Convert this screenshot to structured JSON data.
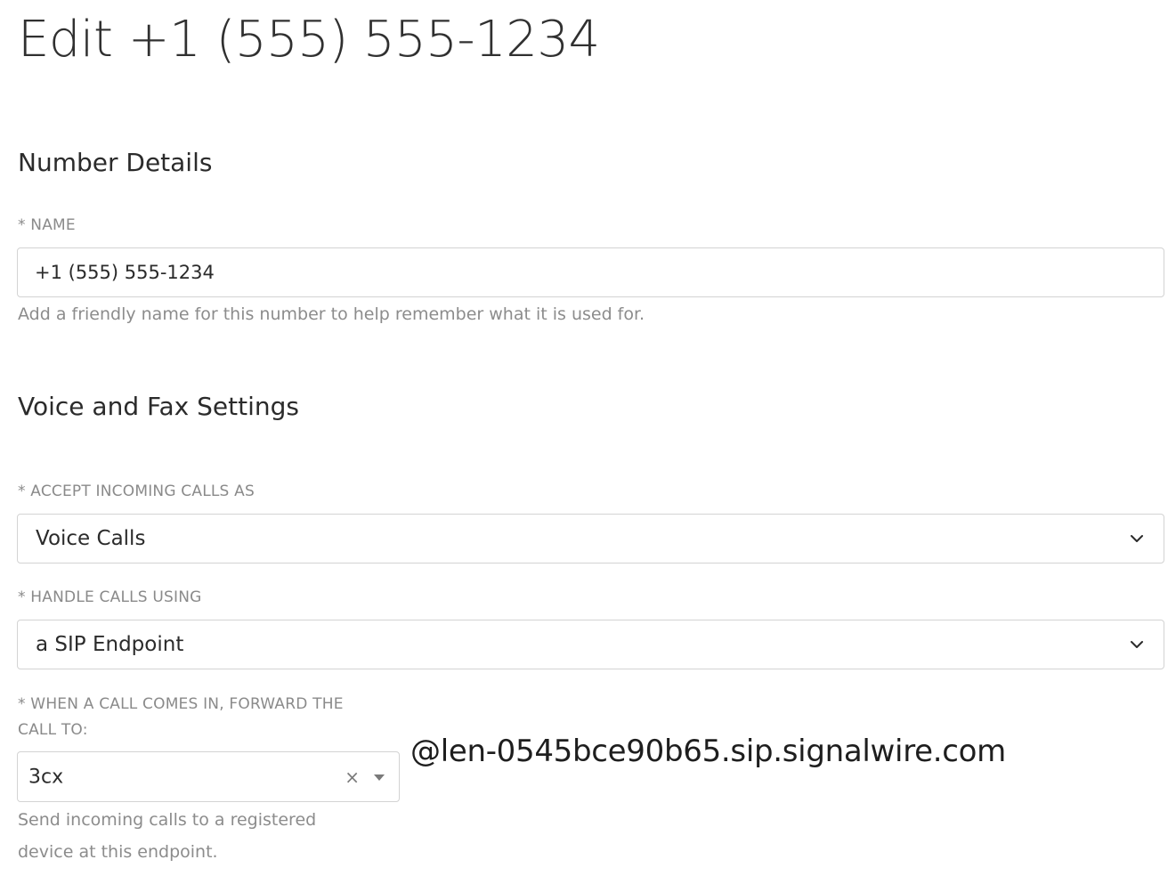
{
  "page": {
    "title": "Edit +1 (555) 555-1234"
  },
  "number_details": {
    "section_title": "Number Details",
    "name_label": "* NAME",
    "name_value": "+1 (555) 555-1234",
    "name_help": "Add a friendly name for this number to help remember what it is used for."
  },
  "voice_fax": {
    "section_title": "Voice and Fax Settings",
    "accept_label": "* ACCEPT INCOMING CALLS AS",
    "accept_value": "Voice Calls",
    "handle_label": "* HANDLE CALLS USING",
    "handle_value": "a SIP Endpoint",
    "forward_label_line1": "* WHEN A CALL COMES IN, FORWARD THE",
    "forward_label_line2": "CALL TO:",
    "forward_value": "3cx",
    "forward_clear_icon": "×",
    "forward_domain": "@len-0545bce90b65.sip.signalwire.com",
    "forward_help_line1": "Send incoming calls to a registered",
    "forward_help_line2": "device at this endpoint."
  },
  "icons": {
    "chevron": "chevron-down-icon",
    "clear": "close-icon",
    "caret": "caret-down-icon"
  }
}
